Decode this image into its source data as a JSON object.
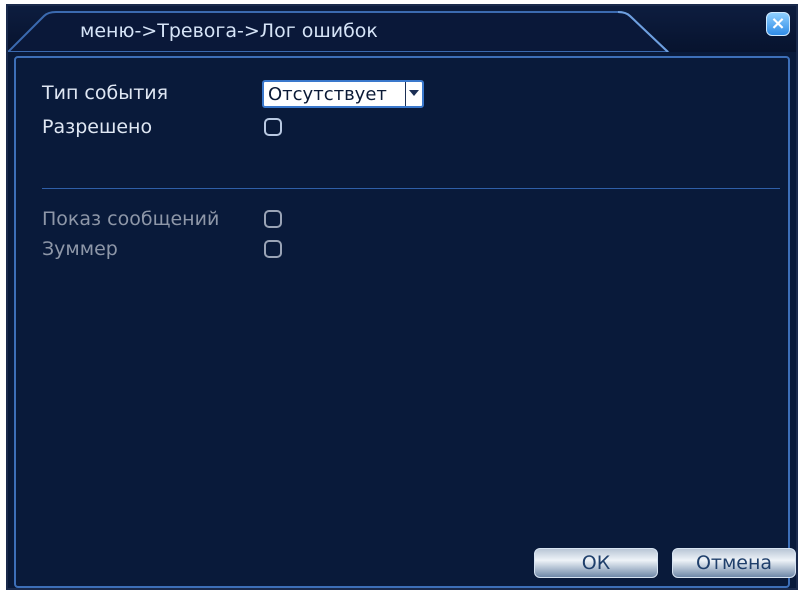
{
  "window": {
    "title": "меню->Тревога->Лог ошибок",
    "close_icon": "close-icon"
  },
  "form": {
    "event_type": {
      "label": "Тип события",
      "value": "Отсутствует"
    },
    "enabled": {
      "label": "Разрешено",
      "checked": false
    },
    "show_message": {
      "label": "Показ сообщений",
      "checked": false
    },
    "buzzer": {
      "label": "Зуммер",
      "checked": false
    }
  },
  "buttons": {
    "ok": "ОК",
    "cancel": "Отмена"
  },
  "colors": {
    "background": "#091a3a",
    "accent": "#3d6fb8",
    "text": "#dfe7f3",
    "disabled_text": "#8e97a8"
  }
}
